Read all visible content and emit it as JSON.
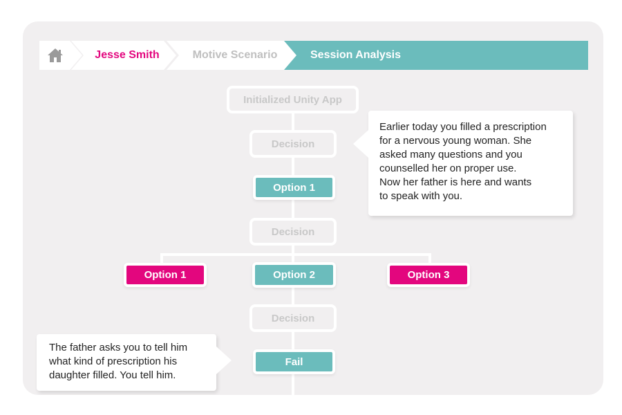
{
  "breadcrumb": {
    "home_icon": "home-icon",
    "user_name": "Jesse Smith",
    "scenario": "Motive Scenario",
    "current": "Session Analysis"
  },
  "flow": {
    "start": "Initialized Unity App",
    "decision_1": "Decision",
    "option_1_top": "Option 1",
    "decision_2": "Decision",
    "branch_options": [
      "Option 1",
      "Option 2",
      "Option 3"
    ],
    "decision_3": "Decision",
    "result": "Fail"
  },
  "bubbles": {
    "scenario_text": "Earlier today you filled a prescription\nfor a nervous young woman. She\nasked many questions and you\ncounselled her on proper use.\nNow her father is here and wants\nto speak with you.",
    "result_text": "The father asks you to tell him\nwhat kind of prescription his\ndaughter filled. You tell him."
  },
  "colors": {
    "accent_teal": "#6bbcbc",
    "accent_pink": "#e3067e",
    "panel_bg": "#f1eff0",
    "inactive_text": "#bfbfbf"
  }
}
